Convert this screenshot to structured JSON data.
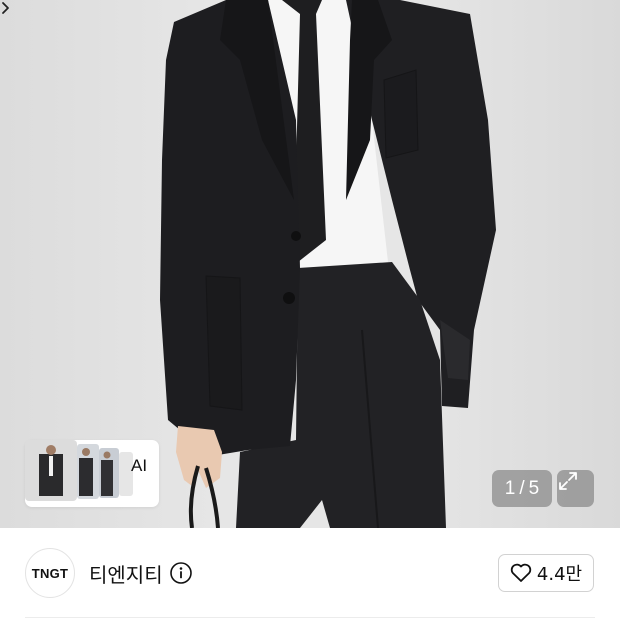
{
  "gallery": {
    "ai_label": "AI",
    "current_page": "1",
    "page_separator": "/",
    "total_pages": "5"
  },
  "brand": {
    "logo_text": "TNGT",
    "name": "티엔지티"
  },
  "like": {
    "count": "4.4만"
  },
  "icons": [
    "chevron-right-icon",
    "expand-icon",
    "info-icon",
    "heart-icon"
  ],
  "colors": {
    "suit": "#1c1c1e",
    "shirt": "#f7f7f7",
    "background": "#e3e3e3"
  }
}
